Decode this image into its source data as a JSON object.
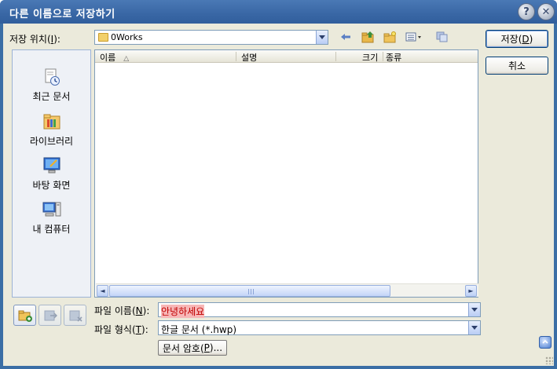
{
  "window": {
    "title": "다른 이름으로 저장하기",
    "help_glyph": "?",
    "close_glyph": "✕"
  },
  "location": {
    "label_prefix": "저장 위치(",
    "label_key": "I",
    "label_suffix": "):",
    "value": "0Works"
  },
  "toolbar": {
    "icons": [
      "back-arrow-icon",
      "up-folder-icon",
      "new-folder-icon",
      "view-menu-icon",
      "tools-icon"
    ]
  },
  "places": [
    {
      "name": "recent",
      "label": "최근 문서",
      "icon": "recent-documents-icon"
    },
    {
      "name": "library",
      "label": "라이브러리",
      "icon": "library-icon"
    },
    {
      "name": "desktop",
      "label": "바탕 화면",
      "icon": "desktop-icon"
    },
    {
      "name": "computer",
      "label": "내 컴퓨터",
      "icon": "my-computer-icon"
    }
  ],
  "filelist": {
    "columns": [
      "이름",
      "설명",
      "크기",
      "종류"
    ],
    "sort_glyph": "△",
    "scroll_left": "◄",
    "scroll_right": "►"
  },
  "filename": {
    "label_prefix": "파일 이름(",
    "label_key": "N",
    "label_suffix": "):",
    "value": "안녕하세요"
  },
  "filetype": {
    "label_prefix": "파일 형식(",
    "label_key": "T",
    "label_suffix": "):",
    "value": "한글 문서 (*.hwp)"
  },
  "buttons": {
    "save_prefix": "저장(",
    "save_key": "D",
    "save_suffix": ")",
    "cancel": "취소",
    "password_prefix": "문서 암호(",
    "password_key": "P",
    "password_suffix": ")..."
  },
  "colors": {
    "title_bar": "#3a68a6",
    "dialog_bg": "#ebeadb",
    "highlight": "#f7b7b7"
  }
}
